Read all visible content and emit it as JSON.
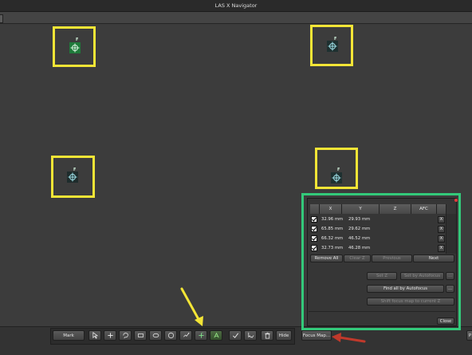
{
  "window": {
    "title": "LAS X Navigator"
  },
  "markers": [
    {
      "name": "position-marker-1",
      "label": "F"
    },
    {
      "name": "position-marker-2",
      "label": "F"
    },
    {
      "name": "position-marker-3",
      "label": "F"
    },
    {
      "name": "position-marker-4",
      "label": "F"
    }
  ],
  "toolbar": {
    "mark_label": "Mark",
    "hide_label": "Hide",
    "focus_map_label": "Focus Map...",
    "right_stub_label": "P"
  },
  "focus_panel": {
    "columns": [
      "X",
      "Y",
      "Z",
      "AFC"
    ],
    "rows": [
      {
        "checked": true,
        "x": "32.96 mm",
        "y": "29.93 mm",
        "z": "",
        "delete": "X"
      },
      {
        "checked": true,
        "x": "65.85 mm",
        "y": "29.62 mm",
        "z": "",
        "delete": "X"
      },
      {
        "checked": true,
        "x": "66.32 mm",
        "y": "46.52 mm",
        "z": "",
        "delete": "X"
      },
      {
        "checked": true,
        "x": "32.73 mm",
        "y": "46.28 mm",
        "z": "",
        "delete": "X"
      }
    ],
    "remove_all": "Remove All",
    "clear_z": "Clear Z",
    "previous": "Previous",
    "next": "Next",
    "set_z": "Set Z",
    "set_by_autofocus": "Set by Autofocus",
    "more": "...",
    "find_all_by_autofocus": "Find all by Autofocus",
    "shift_focus_map": "Shift focus map to current Z",
    "close": "Close"
  },
  "colors": {
    "highlight_yellow": "#f3e536",
    "highlight_green": "#33c97a",
    "arrow_red": "#c0392b",
    "marker_green": "#1f7a3a"
  }
}
